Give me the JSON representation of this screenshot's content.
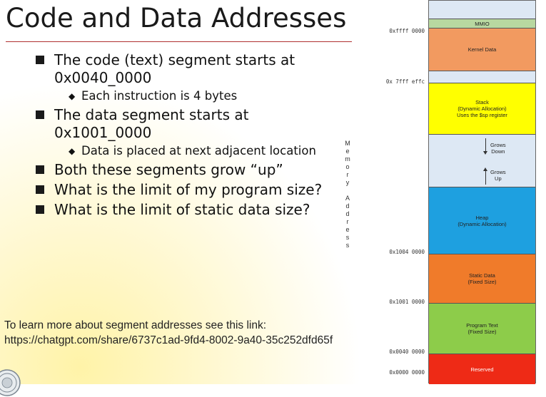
{
  "slide": {
    "title": "Code and Data Addresses",
    "bullets": [
      {
        "text": "The code (text) segment starts at 0x0040_0000",
        "sub": [
          "Each instruction is 4 bytes"
        ]
      },
      {
        "text": "The data segment starts at 0x1001_0000",
        "sub": [
          "Data is placed at next adjacent location"
        ]
      },
      {
        "text": "Both these segments grow “up”",
        "sub": []
      },
      {
        "text": "What is the limit of my program size?",
        "sub": []
      },
      {
        "text": "What is the limit of static data size?",
        "sub": []
      }
    ],
    "footer_line1": "To learn more about segment addresses see this link:",
    "footer_line2": "https://chatgpt.com/share/6737c1ad-9fd4-8002-9a40-35c252dfd65f"
  },
  "memory_map": {
    "axis_label": "Memory Address",
    "segments": {
      "mmio": "MMIO",
      "kernel": "Kernel Data",
      "stack_l1": "Stack",
      "stack_l2": "(Dynamic Allocation)",
      "stack_l3": "Uses the $sp register",
      "grows_down_l1": "Grows",
      "grows_down_l2": "Down",
      "grows_up_l1": "Grows",
      "grows_up_l2": "Up",
      "heap_l1": "Heap",
      "heap_l2": "(Dynamic Allocation)",
      "static_l1": "Static Data",
      "static_l2": "(Fixed Size)",
      "text_l1": "Program Text",
      "text_l2": "(Fixed Size)",
      "reserved": "Reserved"
    },
    "addresses": {
      "ffff": "0xffff 0000",
      "stack_top": "0x 7fff effc",
      "heap_base": "0x1004 0000",
      "data_base": "0x1001 0000",
      "text_base": "0x0040 0000",
      "zero": "0x0000 0000"
    },
    "colors": {
      "top": "#dde8f4",
      "mmio": "#b8d8a0",
      "kernel": "#f29a60",
      "gap": "#dde8f4",
      "stack": "#ffff00",
      "free": "#dde8f4",
      "heap": "#1ea0e0",
      "static": "#f07b2a",
      "text": "#8dcc4a",
      "reserved": "#ee2a16"
    }
  }
}
